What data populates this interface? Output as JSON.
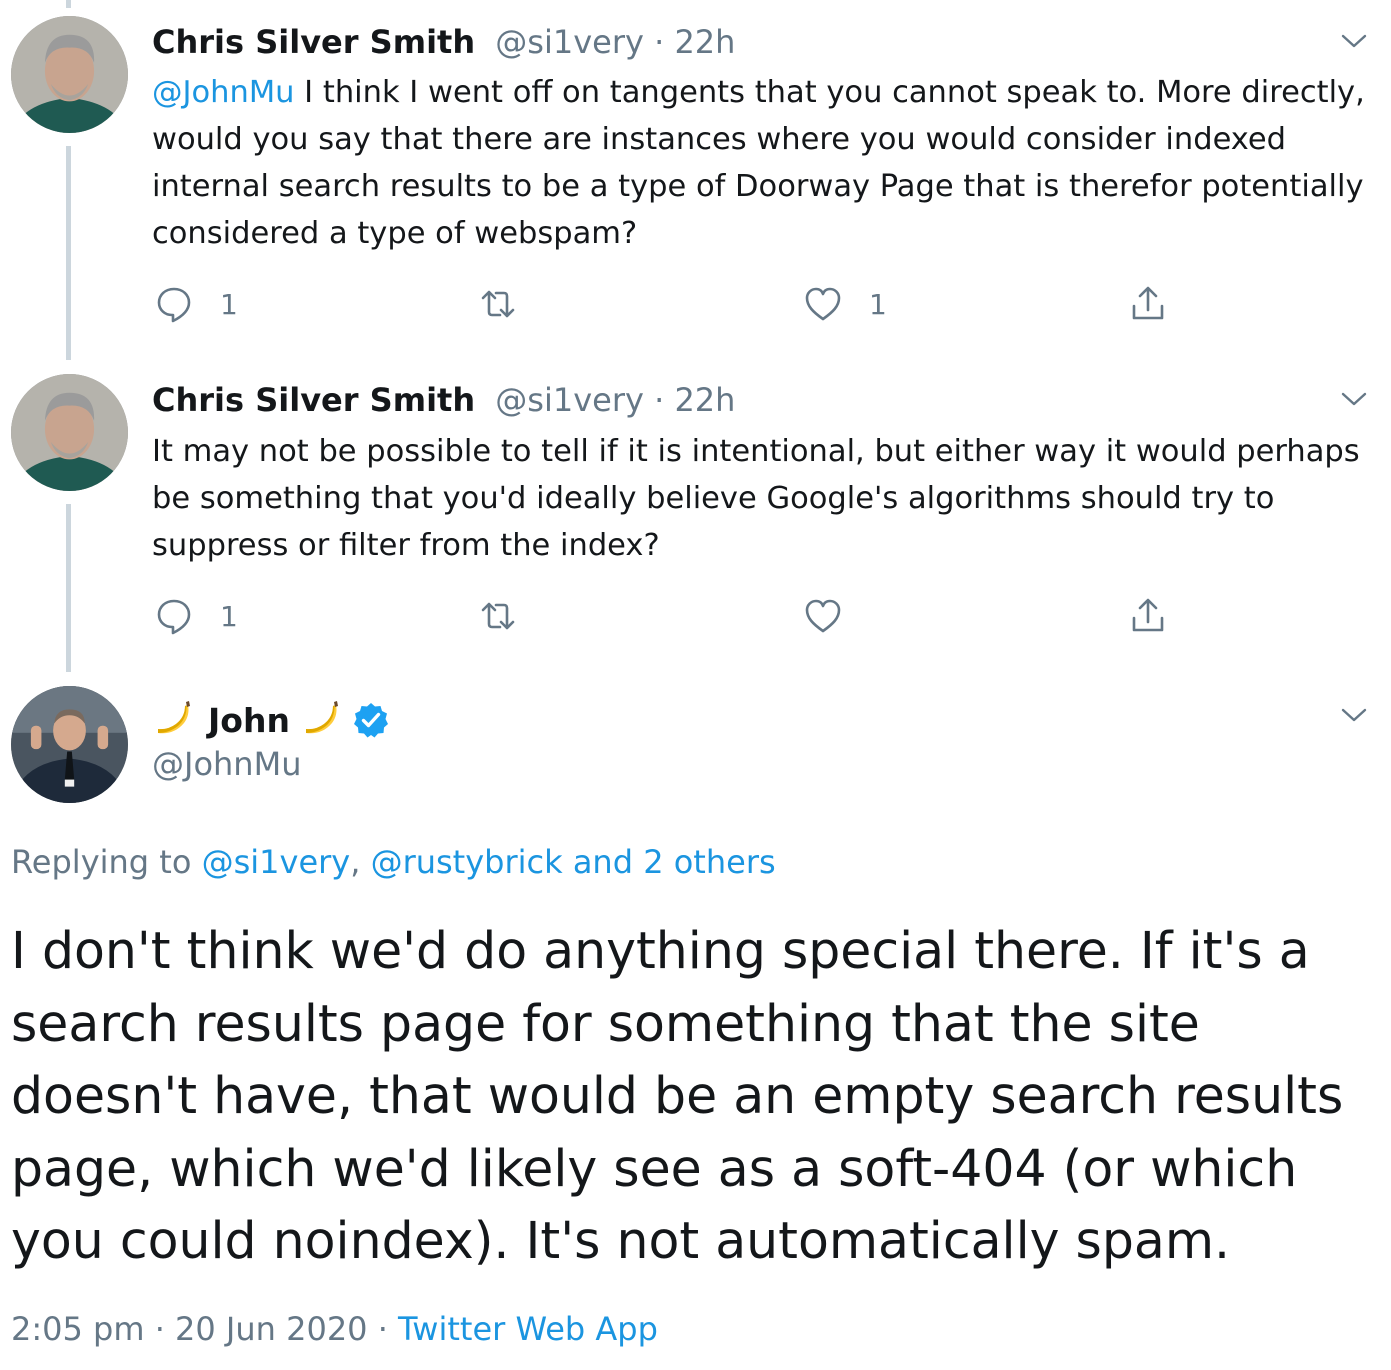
{
  "replies": [
    {
      "author_name": "Chris Silver Smith",
      "handle": "@si1very",
      "separator": "·",
      "time": "22h",
      "text_mention": "@JohnMu",
      "text_body": " I think I went off on tangents that you cannot speak to. More directly, would you say that there are instances where you would consider indexed internal search results to be a type of Doorway Page that is therefor potentially considered a type of webspam?",
      "reply_count": "1",
      "retweet_count": "",
      "like_count": "1"
    },
    {
      "author_name": "Chris Silver Smith",
      "handle": "@si1very",
      "separator": "·",
      "time": "22h",
      "text_mention": "",
      "text_body": "It may not be possible to tell if it is intentional, but either way it would perhaps be something that you'd ideally believe Google's algorithms should try to suppress or filter from the index?",
      "reply_count": "1",
      "retweet_count": "",
      "like_count": ""
    }
  ],
  "main_tweet": {
    "author_name": "John",
    "handle": "@JohnMu",
    "replying_prefix": "Replying to ",
    "replying_user_1": "@si1very",
    "replying_comma": ", ",
    "replying_user_2": "@rustybrick",
    "replying_others": " and 2 others",
    "text": "I don't think we'd do anything special there. If it's a search results page for something that the site doesn't have, that would be an empty search results page, which we'd likely see as a soft-404 (or which you could noindex). It's not automatically spam.",
    "time": "2:05 pm",
    "dot": " · ",
    "date": "20 Jun 2020",
    "source": "Twitter Web App"
  },
  "icons": {
    "reply": "reply-icon",
    "retweet": "retweet-icon",
    "like": "heart-icon",
    "share": "share-icon",
    "caret": "chevron-down-icon",
    "verified": "verified-badge-icon",
    "banana": "banana-emoji-icon"
  },
  "colors": {
    "link": "#1b95e0",
    "secondary_text": "#657786",
    "primary_text": "#14171a",
    "thread_line": "#ccd6dd",
    "verified": "#1da1f2"
  }
}
